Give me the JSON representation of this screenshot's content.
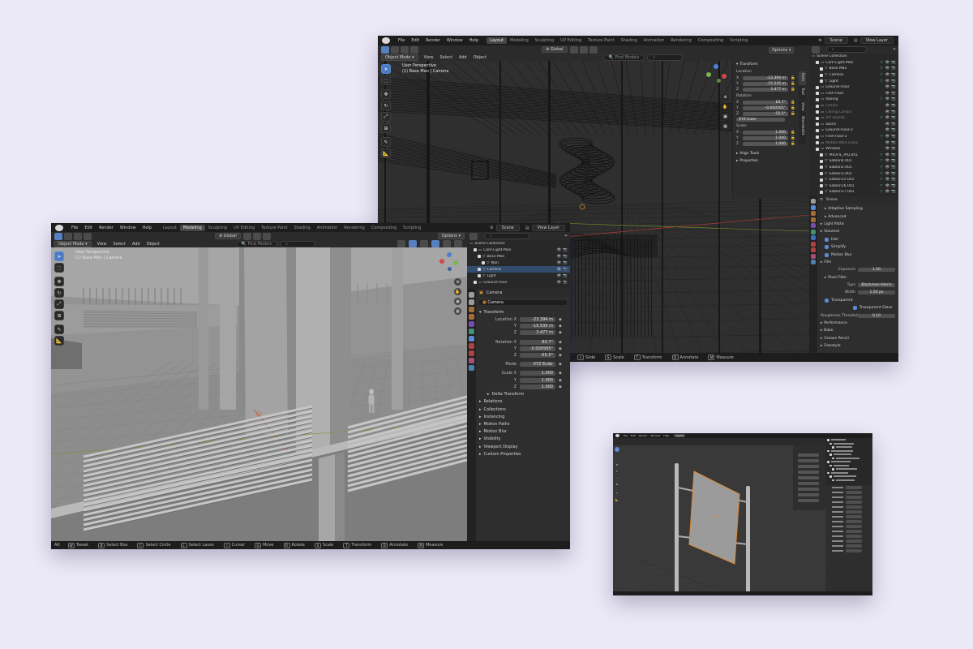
{
  "back_window": {
    "menu": [
      "File",
      "Edit",
      "Render",
      "Window",
      "Help"
    ],
    "workspaces": [
      "Layout",
      "Modeling",
      "Sculpting",
      "UV Editing",
      "Texture Paint",
      "Shading",
      "Animation",
      "Rendering",
      "Compositing",
      "Scripting"
    ],
    "active_workspace": "Layout",
    "scene_name": "Scene",
    "view_layer": "View Layer",
    "header": {
      "mode": "Object Mode",
      "menus": [
        "View",
        "Select",
        "Add",
        "Object"
      ],
      "orientation": "Global",
      "find": "Find Models",
      "options": "Options"
    },
    "viewport_label": [
      "User Perspective",
      "(1) Base Man | Camera"
    ],
    "n_panel": {
      "title": "Transform",
      "location_label": "Location",
      "location": [
        {
          "axis": "X",
          "value": "-23.394 m"
        },
        {
          "axis": "Y",
          "value": "-15.535 m"
        },
        {
          "axis": "Z",
          "value": "3.477 m"
        }
      ],
      "rotation_label": "Rotation",
      "rotation": [
        {
          "axis": "X",
          "value": "83.7°"
        },
        {
          "axis": "Y",
          "value": "-0.000565°"
        },
        {
          "axis": "Z",
          "value": "-55.5°"
        }
      ],
      "mode": "XYZ Euler",
      "scale_label": "Scale:",
      "scale": [
        {
          "axis": "X",
          "value": "1.000"
        },
        {
          "axis": "Y",
          "value": "1.000"
        },
        {
          "axis": "Z",
          "value": "1.000"
        }
      ],
      "sections": [
        "Align Tools",
        "Properties"
      ],
      "side_tabs": [
        "Item",
        "Tool",
        "View",
        "BlenderKit"
      ]
    },
    "outliner": {
      "title": "Scene Collection",
      "items": [
        {
          "name": "Cam-Light-Man",
          "depth": 1,
          "dim": false
        },
        {
          "name": "Base Man",
          "depth": 2,
          "dim": false
        },
        {
          "name": "Camera",
          "depth": 2,
          "dim": false
        },
        {
          "name": "Light",
          "depth": 2,
          "dim": false
        },
        {
          "name": "Ground-Floor",
          "depth": 1,
          "dim": false
        },
        {
          "name": "First-Floor",
          "depth": 1,
          "dim": false
        },
        {
          "name": "Railing",
          "depth": 1,
          "dim": false
        },
        {
          "name": "Lamps",
          "depth": 1,
          "dim": true
        },
        {
          "name": "Ceiling Lamps",
          "depth": 1,
          "dim": true
        },
        {
          "name": "Art Stands",
          "depth": 1,
          "dim": true
        },
        {
          "name": "Stairs",
          "depth": 1,
          "dim": false
        },
        {
          "name": "Ground-Floor-2",
          "depth": 1,
          "dim": false
        },
        {
          "name": "First-Floor-2",
          "depth": 1,
          "dim": false
        },
        {
          "name": "Middle-Wall-Glass",
          "depth": 1,
          "dim": true
        },
        {
          "name": "Window",
          "depth": 1,
          "dim": false
        },
        {
          "name": "PROFIL_PIQ.001",
          "depth": 2,
          "dim": false
        },
        {
          "name": "Sablon4.001",
          "depth": 2,
          "dim": false
        },
        {
          "name": "Sablon2.001",
          "depth": 2,
          "dim": false
        },
        {
          "name": "Sablon3.001",
          "depth": 2,
          "dim": false
        },
        {
          "name": "Sablon15.001",
          "depth": 2,
          "dim": false
        },
        {
          "name": "Sablon16.001",
          "depth": 2,
          "dim": false
        },
        {
          "name": "Sablon17.001",
          "depth": 2,
          "dim": false
        }
      ]
    },
    "properties": {
      "scene": "Scene",
      "rows": [
        {
          "kind": "sub",
          "text": "Adaptive Sampling"
        },
        {
          "kind": "sub",
          "text": "Advanced"
        },
        {
          "kind": "sec",
          "text": "Light Paths"
        },
        {
          "kind": "sec",
          "text": "Volumes"
        },
        {
          "kind": "check",
          "text": "Hair"
        },
        {
          "kind": "check",
          "text": "Simplify"
        },
        {
          "kind": "check",
          "text": "Motion Blur"
        },
        {
          "kind": "sec",
          "text": "Film"
        },
        {
          "kind": "field",
          "label": "Exposure",
          "value": "1.00"
        },
        {
          "kind": "sub",
          "text": "Pixel Filter"
        },
        {
          "kind": "field",
          "label": "Type",
          "value": "Blackman-Harris"
        },
        {
          "kind": "field",
          "label": "Width",
          "value": "1.50 px"
        },
        {
          "kind": "check",
          "text": "Transparent"
        },
        {
          "kind": "checkright",
          "text": "Transparent Glass"
        },
        {
          "kind": "field",
          "label": "Roughness Threshold",
          "value": "0.10"
        },
        {
          "kind": "sec",
          "text": "Performance"
        },
        {
          "kind": "sec",
          "text": "Bake"
        },
        {
          "kind": "sec",
          "text": "Grease Pencil"
        },
        {
          "kind": "sec",
          "text": "Freestyle"
        }
      ]
    },
    "status": [
      {
        "key": "⇧",
        "label": "Slide"
      },
      {
        "key": "S",
        "label": "Scale"
      },
      {
        "key": "T",
        "label": "Transform"
      },
      {
        "key": "D",
        "label": "Annotate"
      },
      {
        "key": "M",
        "label": "Measure"
      }
    ]
  },
  "front_window": {
    "menu": [
      "File",
      "Edit",
      "Render",
      "Window",
      "Help"
    ],
    "workspaces": [
      "Layout",
      "Modeling",
      "Sculpting",
      "UV Editing",
      "Texture Paint",
      "Shading",
      "Animation",
      "Rendering",
      "Compositing",
      "Scripting"
    ],
    "active_workspace": "Modeling",
    "scene_name": "Scene",
    "view_layer": "View Layer",
    "header": {
      "mode": "Object Mode",
      "menus": [
        "View",
        "Select",
        "Add",
        "Object"
      ],
      "orientation": "Global",
      "find": "Find Models",
      "options": "Options"
    },
    "viewport_label": [
      "User Perspective",
      "(1) Base Man | Camera"
    ],
    "outliner": {
      "title": "Scene Collection",
      "items": [
        {
          "name": "Cam-Light-Man",
          "depth": 1
        },
        {
          "name": "Base Man",
          "depth": 2
        },
        {
          "name": "Man",
          "depth": 3
        },
        {
          "name": "Camera",
          "depth": 2
        },
        {
          "name": "Light",
          "depth": 2
        },
        {
          "name": "Ground-Floor",
          "depth": 1
        }
      ]
    },
    "properties": {
      "object_name": "Camera",
      "object_field": "Camera",
      "transform_title": "Transform",
      "rows": [
        {
          "label": "Location X",
          "value": "-23.394 m"
        },
        {
          "label": "Y",
          "value": "-15.535 m"
        },
        {
          "label": "Z",
          "value": "3.477 m"
        },
        {
          "label": "Rotation X",
          "value": "83.7°"
        },
        {
          "label": "Y",
          "value": "-0.000565°"
        },
        {
          "label": "Z",
          "value": "-55.5°"
        },
        {
          "label": "Mode",
          "value": "XYZ Euler"
        },
        {
          "label": "Scale X",
          "value": "1.000"
        },
        {
          "label": "Y",
          "value": "1.000"
        },
        {
          "label": "Z",
          "value": "1.000"
        }
      ],
      "delta": "Delta Transform",
      "sections": [
        "Relations",
        "Collections",
        "Instancing",
        "Motion Paths",
        "Motion Blur",
        "Visibility",
        "Viewport Display",
        "Custom Properties"
      ]
    },
    "status": [
      {
        "key": "W",
        "label": "Tweak"
      },
      {
        "key": "B",
        "label": "Select Box"
      },
      {
        "key": "C",
        "label": "Select Circle"
      },
      {
        "key": "L",
        "label": "Select Lasso"
      },
      {
        "key": "⇧",
        "label": "Cursor"
      },
      {
        "key": "G",
        "label": "Move"
      },
      {
        "key": "R",
        "label": "Rotate"
      },
      {
        "key": "S",
        "label": "Scale"
      },
      {
        "key": "T",
        "label": "Transform"
      },
      {
        "key": "D",
        "label": "Annotate"
      },
      {
        "key": "M",
        "label": "Measure"
      }
    ],
    "status_prefix": "Alt"
  },
  "small_window": {
    "menu": [
      "File",
      "Edit",
      "Render",
      "Window",
      "Help"
    ],
    "active_workspace": "Layout"
  },
  "colors": {
    "background": "#ebe9f6",
    "selection_blue": "#4a7bc4",
    "object_orange": "#ee9b3a",
    "data_green": "#4fae8d",
    "axis_red": "#c23b3b",
    "axis_green": "#7a9a2d"
  }
}
